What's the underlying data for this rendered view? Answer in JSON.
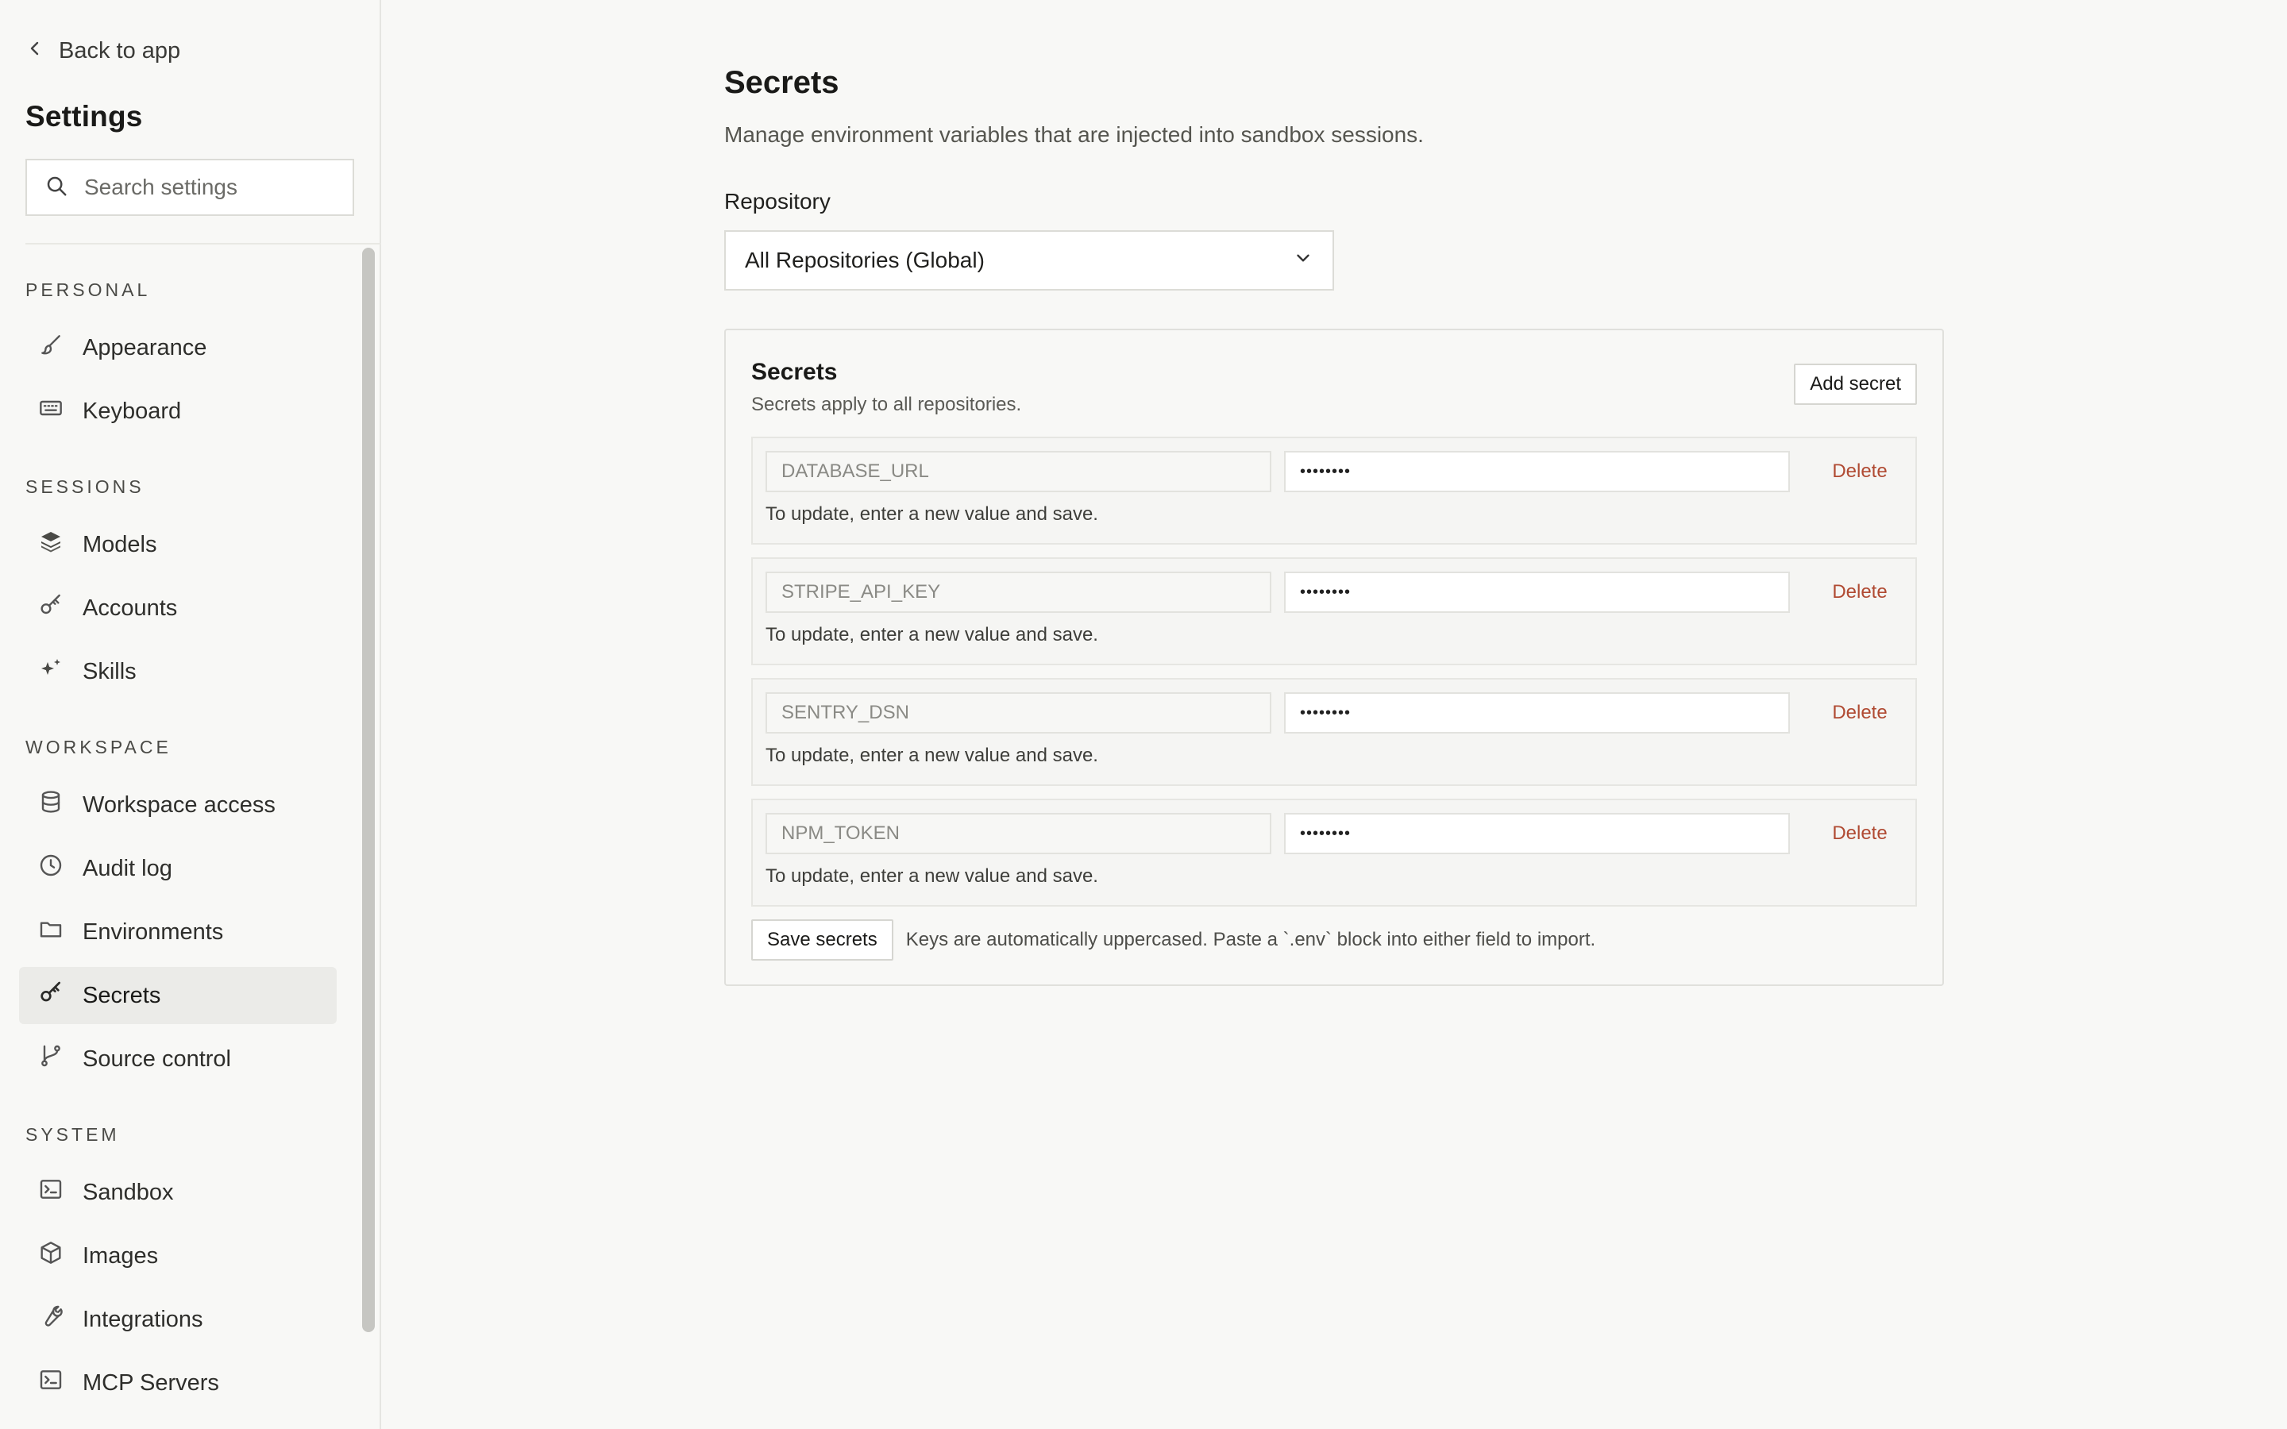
{
  "sidebar": {
    "back_label": "Back to app",
    "title": "Settings",
    "search_placeholder": "Search settings",
    "groups": [
      {
        "label": "PERSONAL",
        "items": [
          {
            "label": "Appearance",
            "icon": "brush-icon"
          },
          {
            "label": "Keyboard",
            "icon": "keyboard-icon"
          }
        ]
      },
      {
        "label": "SESSIONS",
        "items": [
          {
            "label": "Models",
            "icon": "layers-icon"
          },
          {
            "label": "Accounts",
            "icon": "key-icon"
          },
          {
            "label": "Skills",
            "icon": "sparkles-icon"
          }
        ]
      },
      {
        "label": "WORKSPACE",
        "items": [
          {
            "label": "Workspace access",
            "icon": "database-icon"
          },
          {
            "label": "Audit log",
            "icon": "clock-icon"
          },
          {
            "label": "Environments",
            "icon": "folder-icon"
          },
          {
            "label": "Secrets",
            "icon": "key-icon",
            "active": true
          },
          {
            "label": "Source control",
            "icon": "git-branch-icon"
          }
        ]
      },
      {
        "label": "SYSTEM",
        "items": [
          {
            "label": "Sandbox",
            "icon": "terminal-icon"
          },
          {
            "label": "Images",
            "icon": "box-icon"
          },
          {
            "label": "Integrations",
            "icon": "wrench-icon"
          },
          {
            "label": "MCP Servers",
            "icon": "terminal-icon"
          }
        ]
      }
    ]
  },
  "main": {
    "title": "Secrets",
    "subtitle": "Manage environment variables that are injected into sandbox sessions.",
    "repo_label": "Repository",
    "repo_value": "All Repositories (Global)",
    "panel": {
      "title": "Secrets",
      "subtitle": "Secrets apply to all repositories.",
      "add_label": "Add secret",
      "rows": [
        {
          "key": "DATABASE_URL",
          "value": "••••••••",
          "delete_label": "Delete",
          "hint": "To update, enter a new value and save."
        },
        {
          "key": "STRIPE_API_KEY",
          "value": "••••••••",
          "delete_label": "Delete",
          "hint": "To update, enter a new value and save."
        },
        {
          "key": "SENTRY_DSN",
          "value": "••••••••",
          "delete_label": "Delete",
          "hint": "To update, enter a new value and save."
        },
        {
          "key": "NPM_TOKEN",
          "value": "••••••••",
          "delete_label": "Delete",
          "hint": "To update, enter a new value and save."
        }
      ],
      "save_label": "Save secrets",
      "footnote": "Keys are automatically uppercased. Paste a `.env` block into either field to import."
    }
  },
  "colors": {
    "background": "#f8f8f6",
    "active_item": "#ebebe8",
    "delete": "#b04a32"
  }
}
